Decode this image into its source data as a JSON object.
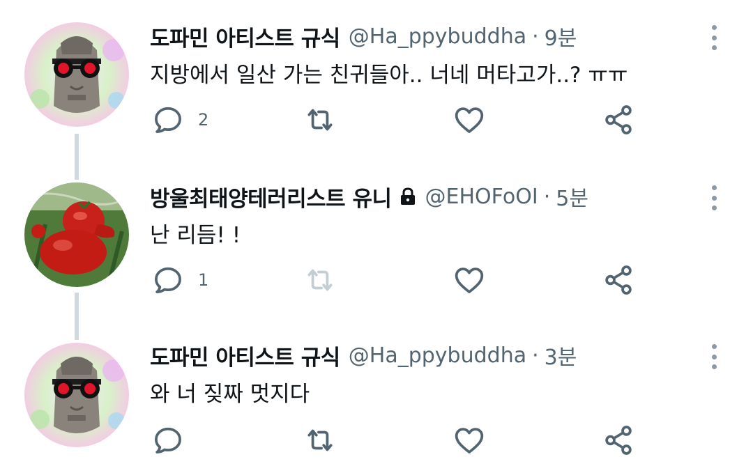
{
  "tweets": [
    {
      "display_name": "도파민 아티스트 규식",
      "handle": "@Ha_ppybuddha",
      "separator": "·",
      "time": "9분",
      "text": "지방에서 일산 가는 친귀들아.. 너네 머타고가..? ㅠㅠ",
      "reply_count": "2",
      "protected": false,
      "avatar": "buddha-avatar"
    },
    {
      "display_name": "방울최태양테러리스트 유니",
      "handle": "@EHOFoOI",
      "separator": "·",
      "time": "5분",
      "text": "난 리듬! !",
      "reply_count": "1",
      "protected": true,
      "avatar": "tomato-avatar"
    },
    {
      "display_name": "도파민 아티스트 규식",
      "handle": "@Ha_ppybuddha",
      "separator": "·",
      "time": "3분",
      "text": "와 너 짖짜 멋지다",
      "reply_count": "",
      "protected": false,
      "avatar": "buddha-avatar"
    }
  ],
  "icons": {
    "reply": "reply-icon",
    "retweet": "retweet-icon",
    "like": "like-icon",
    "share": "share-icon",
    "more": "more-icon",
    "lock": "lock-icon"
  },
  "colors": {
    "text_primary": "#0f1419",
    "text_secondary": "#536471",
    "icon": "#536471",
    "icon_disabled": "#c3cdd4",
    "thread_line": "#cfd9de"
  }
}
